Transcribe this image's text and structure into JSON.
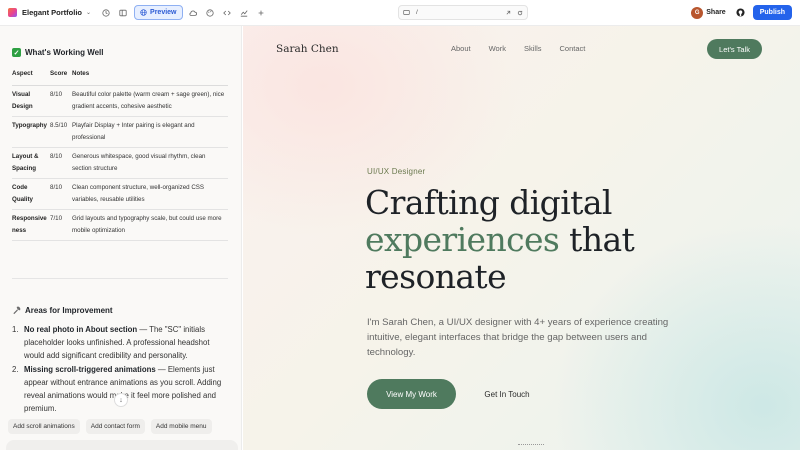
{
  "topbar": {
    "project_name": "Elegant Portfolio",
    "preview_label": "Preview",
    "url_path": "/",
    "share_label": "Share",
    "publish_label": "Publish",
    "avatar_initial": "G"
  },
  "left": {
    "working_well": {
      "heading": "What's Working Well",
      "columns": [
        "Aspect",
        "Score",
        "Notes"
      ],
      "rows": [
        {
          "aspect": "Visual Design",
          "score": "8/10",
          "notes": "Beautiful color palette (warm cream + sage green), nice gradient accents, cohesive aesthetic"
        },
        {
          "aspect": "Typography",
          "score": "8.5/10",
          "notes": "Playfair Display + Inter pairing is elegant and professional"
        },
        {
          "aspect": "Layout & Spacing",
          "score": "8/10",
          "notes": "Generous whitespace, good visual rhythm, clean section structure"
        },
        {
          "aspect": "Code Quality",
          "score": "8/10",
          "notes": "Clean component structure, well-organized CSS variables, reusable utilities"
        },
        {
          "aspect": "Responsiveness",
          "score": "7/10",
          "notes": "Grid layouts and typography scale, but could use more mobile optimization"
        }
      ]
    },
    "improvement": {
      "heading": "Areas for Improvement",
      "items": [
        {
          "num": "1.",
          "title": "No real photo in About section",
          "text": " — The \"SC\" initials placeholder looks unfinished. A professional headshot would add significant credibility and personality."
        },
        {
          "num": "2.",
          "title": "Missing scroll-triggered animations",
          "text": " — Elements just appear without entrance animations as you scroll. Adding reveal animations would make it feel more polished and premium."
        }
      ]
    },
    "chips": [
      "Add scroll animations",
      "Add contact form",
      "Add mobile menu"
    ]
  },
  "preview": {
    "logo": "Sarah Chen",
    "nav": [
      "About",
      "Work",
      "Skills",
      "Contact"
    ],
    "cta": "Let's Talk",
    "eyebrow": "UI/UX Designer",
    "title_1": "Crafting digital",
    "title_accent": "experiences",
    "title_2": " that",
    "title_3": "resonate",
    "description": "I'm Sarah Chen, a UI/UX designer with 4+ years of experience creating intuitive, elegant interfaces that bridge the gap between users and technology.",
    "primary_button": "View My Work",
    "secondary_button": "Get In Touch"
  },
  "colors": {
    "accent": "#4f7a5e",
    "publish": "#2463eb",
    "preview_active": "#2c5bd4"
  }
}
